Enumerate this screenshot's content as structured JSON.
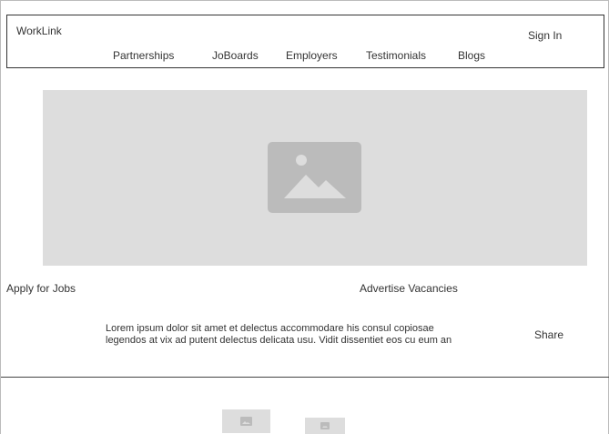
{
  "header": {
    "brand": "WorkLink",
    "sign_in": "Sign In",
    "nav": [
      "Partnerships",
      "JoBoards",
      "Employers",
      "Testimonials",
      "Blogs"
    ]
  },
  "hero": {
    "icon": "image-placeholder-icon"
  },
  "actions": {
    "apply": "Apply for Jobs",
    "advertise": "Advertise Vacancies"
  },
  "content": {
    "line1": "Lorem ipsum dolor sit amet et delectus accommodare his consul copiosae",
    "line2": "legendos at vix ad putent delectus delicata usu. Vidit dissentiet eos cu eum an",
    "share": "Share"
  },
  "footer": {
    "thumbnails": [
      "image-placeholder-icon",
      "image-placeholder-icon"
    ]
  },
  "colors": {
    "placeholder_bg": "#dddddd",
    "placeholder_icon": "#bbbbbb",
    "text": "#333333"
  }
}
